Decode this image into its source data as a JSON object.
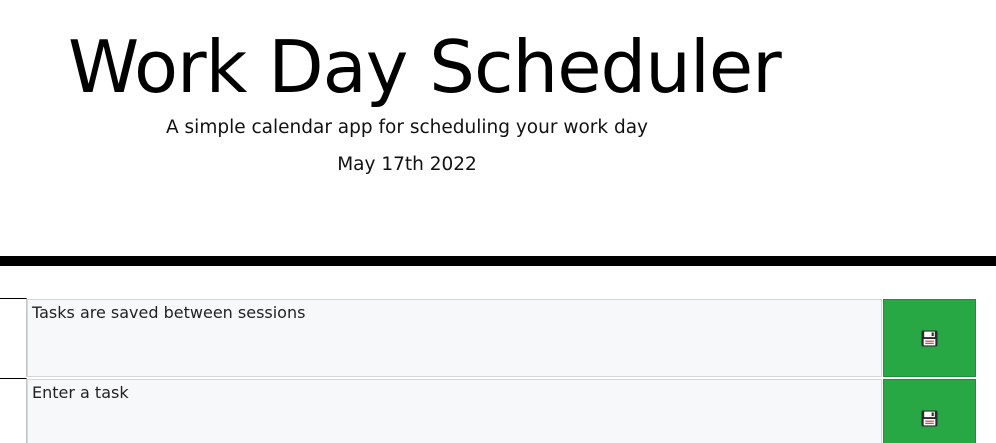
{
  "header": {
    "title": "Work Day Scheduler",
    "lead": "A simple calendar app for scheduling your work day",
    "current_day": "May 17th 2022"
  },
  "schedule": {
    "rows": [
      {
        "task": "Tasks are saved between sessions",
        "save_icon": "floppy-disk-icon"
      },
      {
        "task": "Enter a task",
        "save_icon": "floppy-disk-icon"
      }
    ]
  },
  "colors": {
    "save_button": "#28a745",
    "task_background": "#f7f8fa",
    "divider": "#000000"
  }
}
